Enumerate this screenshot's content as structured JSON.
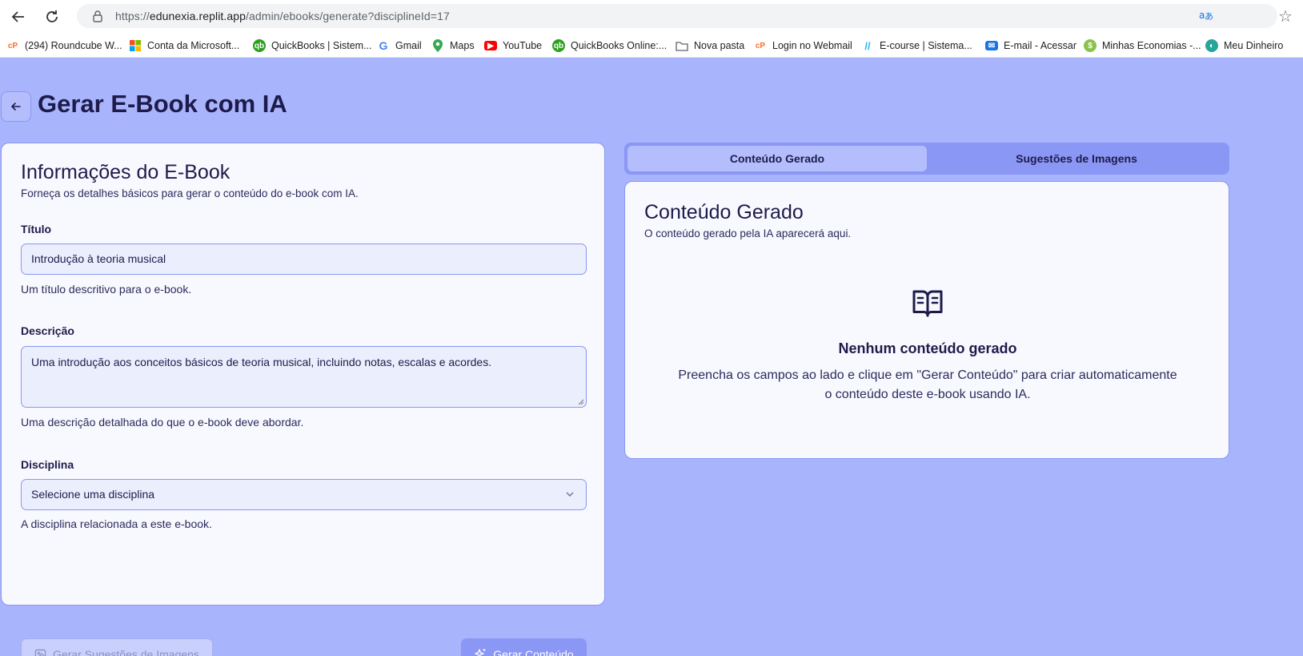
{
  "browser": {
    "url_prefix": "https://",
    "url_host": "edunexia.replit.app",
    "url_path": "/admin/ebooks/generate?disciplineId=17",
    "bookmarks": [
      {
        "label": "(294) Roundcube W...",
        "icon": "cpanel-icon",
        "color": "#ff6c2c"
      },
      {
        "label": "Conta da Microsoft...",
        "icon": "microsoft-icon",
        "color": "#f25022"
      },
      {
        "label": "QuickBooks | Sistem...",
        "icon": "quickbooks-icon",
        "color": "#2ca01c"
      },
      {
        "label": "Gmail",
        "icon": "google-icon",
        "color": "#4285f4"
      },
      {
        "label": "Maps",
        "icon": "maps-pin-icon",
        "color": "#34a853"
      },
      {
        "label": "YouTube",
        "icon": "youtube-icon",
        "color": "#ff0000"
      },
      {
        "label": "QuickBooks Online:...",
        "icon": "quickbooks-icon",
        "color": "#2ca01c"
      },
      {
        "label": "Nova pasta",
        "icon": "folder-icon",
        "color": "#5f6368"
      },
      {
        "label": "Login no Webmail",
        "icon": "cpanel-icon",
        "color": "#ff6c2c"
      },
      {
        "label": "E-course | Sistema...",
        "icon": "ecourse-icon",
        "color": "#29b6f6"
      },
      {
        "label": "E-mail - Acessar",
        "icon": "mail-icon",
        "color": "#1a73e8"
      },
      {
        "label": "Minhas Economias -...",
        "icon": "economias-icon",
        "color": "#8bc34a"
      },
      {
        "label": "Meu Dinheiro",
        "icon": "dinheiro-icon",
        "color": "#26a69a"
      }
    ]
  },
  "page": {
    "title": "Gerar E-Book com IA"
  },
  "form": {
    "title": "Informações do E-Book",
    "subtitle": "Forneça os detalhes básicos para gerar o conteúdo do e-book com IA.",
    "title_label": "Título",
    "title_value": "Introdução à teoria musical",
    "title_hint": "Um título descritivo para o e-book.",
    "description_label": "Descrição",
    "description_value": "Uma introdução aos conceitos básicos de teoria musical, incluindo notas, escalas e acordes.",
    "description_hint": "Uma descrição detalhada do que o e-book deve abordar.",
    "discipline_label": "Disciplina",
    "discipline_value": "Selecione uma disciplina",
    "discipline_hint": "A disciplina relacionada a este e-book.",
    "image_button": "Gerar Sugestões de Imagens",
    "generate_button": "Gerar Conteúdo"
  },
  "tabs": {
    "content": "Conteúdo Gerado",
    "images": "Sugestões de Imagens"
  },
  "output": {
    "title": "Conteúdo Gerado",
    "subtitle": "O conteúdo gerado pela IA aparecerá aqui.",
    "empty_title": "Nenhum conteúdo gerado",
    "empty_text": "Preencha os campos ao lado e clique em \"Gerar Conteúdo\" para criar automaticamente o conteúdo deste e-book usando IA."
  },
  "colors": {
    "app_bg": "#a8b4fc",
    "card_bg": "#f8f9fe",
    "accent": "#8b97f5",
    "text": "#1e1b4b"
  }
}
